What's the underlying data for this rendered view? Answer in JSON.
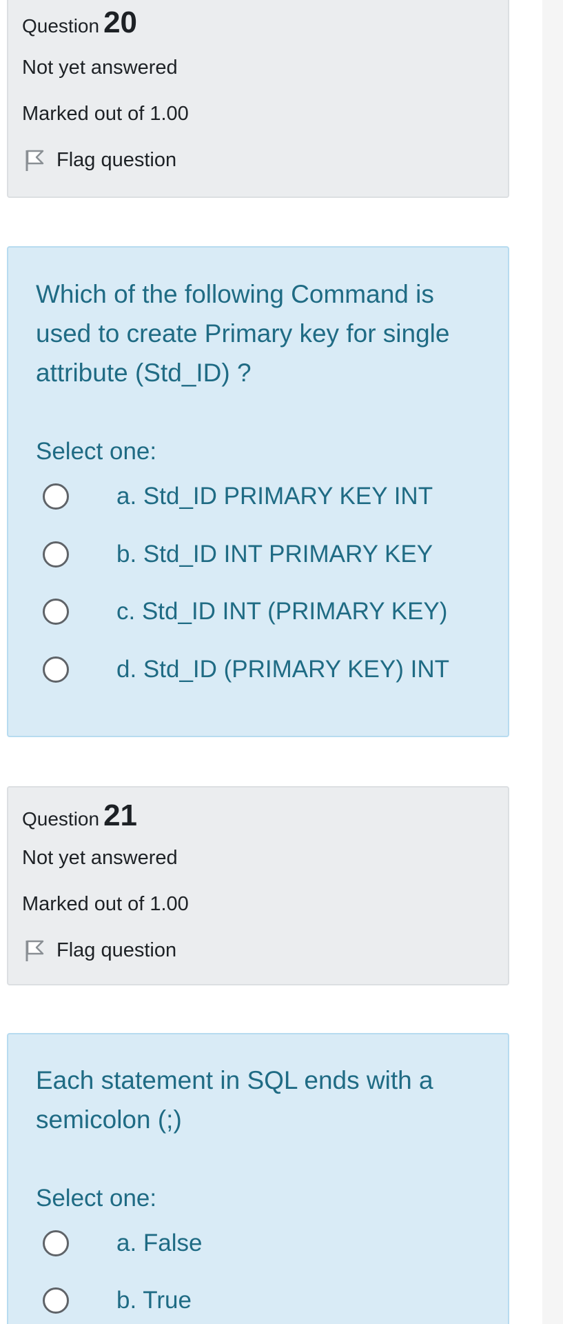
{
  "questions": [
    {
      "question_word": "Question",
      "number": "20",
      "status": "Not yet answered",
      "marks": "Marked out of 1.00",
      "flag_label": "Flag question",
      "text": "Which of the following Command is used to create Primary key for single attribute (Std_ID) ?",
      "select_label": "Select one:",
      "options": [
        "a. Std_ID PRIMARY KEY INT",
        "b. Std_ID INT PRIMARY KEY",
        "c. Std_ID INT (PRIMARY KEY)",
        "d. Std_ID (PRIMARY KEY) INT"
      ]
    },
    {
      "question_word": "Question",
      "number": "21",
      "status": "Not yet answered",
      "marks": "Marked out of 1.00",
      "flag_label": "Flag question",
      "text": "Each statement in SQL ends with a semicolon (;)",
      "select_label": "Select one:",
      "options": [
        "a. False",
        "b. True"
      ]
    }
  ],
  "icons": {
    "flag": "flag-icon",
    "radio": "radio-unchecked-icon"
  },
  "colors": {
    "info_bg": "#ebedef",
    "content_bg": "#d9ebf6",
    "content_text": "#1f6b84"
  }
}
